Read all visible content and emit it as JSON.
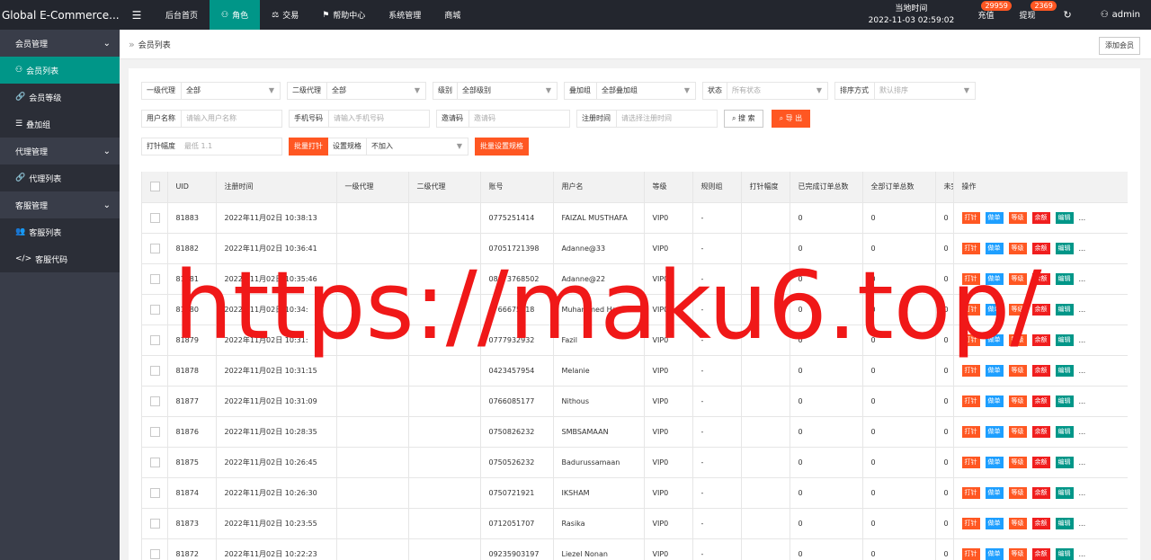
{
  "app": {
    "brand": "Global E-Commerce..."
  },
  "topnav": [
    {
      "label": "后台首页",
      "icon": "",
      "active": false
    },
    {
      "label": "角色",
      "icon": "user-icon",
      "active": true
    },
    {
      "label": "交易",
      "icon": "scale-icon",
      "active": false
    },
    {
      "label": "帮助中心",
      "icon": "flag-icon",
      "active": false
    },
    {
      "label": "系统管理",
      "icon": "",
      "active": false
    },
    {
      "label": "商城",
      "icon": "",
      "active": false
    }
  ],
  "header": {
    "clock_title": "当地时间",
    "clock_value": "2022-11-03 02:59:02",
    "recharge_label": "充值",
    "recharge_badge": "29959",
    "withdraw_label": "提现",
    "withdraw_badge": "2369",
    "user_label": "admin"
  },
  "sidebar": {
    "groups": [
      {
        "label": "会员管理",
        "items": [
          {
            "label": "会员列表",
            "icon": "user-icon",
            "active": true
          },
          {
            "label": "会员等级",
            "icon": "link-icon",
            "active": false
          },
          {
            "label": "叠加组",
            "icon": "list-icon",
            "active": false
          }
        ]
      },
      {
        "label": "代理管理",
        "items": [
          {
            "label": "代理列表",
            "icon": "link-icon",
            "active": false
          }
        ]
      },
      {
        "label": "客服管理",
        "items": [
          {
            "label": "客服列表",
            "icon": "users-icon",
            "active": false
          },
          {
            "label": "客服代码",
            "icon": "code-icon",
            "active": false
          }
        ]
      }
    ]
  },
  "tabbar": {
    "crumb": "会员列表",
    "add_button": "添加会员"
  },
  "filters": {
    "row1": [
      {
        "label": "一级代理",
        "value": "全部"
      },
      {
        "label": "二级代理",
        "value": "全部"
      },
      {
        "label": "级别",
        "value": "全部级别"
      },
      {
        "label": "叠加组",
        "value": "全部叠加组"
      },
      {
        "label": "状态",
        "value": "所有状态"
      },
      {
        "label": "排序方式",
        "value": "默认排序"
      }
    ],
    "row2": [
      {
        "label": "用户名称",
        "placeholder": "请输入用户名称"
      },
      {
        "label": "手机号码",
        "placeholder": "请输入手机号码"
      },
      {
        "label": "邀请码",
        "placeholder": "邀请码"
      },
      {
        "label": "注册时间",
        "placeholder": "请选择注册时间"
      }
    ],
    "search_button": "搜 索",
    "export_button": "导 出",
    "row3": {
      "label": "打针幅度",
      "placeholder": "最低 1.1",
      "batch_button": "批量打针",
      "rule_label": "设置规格",
      "rule_value": "不加入",
      "batch_rule_button": "批量设置规格"
    }
  },
  "table": {
    "columns": [
      "UID",
      "注册时间",
      "一级代理",
      "二级代理",
      "账号",
      "用户名",
      "等级",
      "规则组",
      "打针幅度",
      "已完成订单总数",
      "全部订单总数",
      "未完成",
      "操作"
    ],
    "actions": [
      "打针",
      "做单",
      "等级",
      "余额",
      "编辑"
    ],
    "more": "...",
    "rows": [
      {
        "uid": "81883",
        "time": "2022年11月02日 10:38:13",
        "agent1": "",
        "agent2": "",
        "account": "0775251414",
        "name": "FAIZAL MUSTHAFA",
        "level": "VIP0",
        "rule": "-",
        "range": "",
        "done": "0",
        "total": "0",
        "undone": "0"
      },
      {
        "uid": "81882",
        "time": "2022年11月02日 10:36:41",
        "agent1": "",
        "agent2": "",
        "account": "07051721398",
        "name": "Adanne@33",
        "level": "VIP0",
        "rule": "-",
        "range": "",
        "done": "0",
        "total": "0",
        "undone": "0"
      },
      {
        "uid": "81881",
        "time": "2022年11月02日 10:35:46",
        "agent1": "",
        "agent2": "",
        "account": "08073768502",
        "name": "Adanne@22",
        "level": "VIP0",
        "rule": "-",
        "range": "",
        "done": "0",
        "total": "0",
        "undone": "0"
      },
      {
        "uid": "81880",
        "time": "2022年11月02日 10:34:",
        "agent1": "",
        "agent2": "",
        "account": "0766675118",
        "name": "Muhammed Harun...",
        "level": "VIP0",
        "rule": "-",
        "range": "",
        "done": "0",
        "total": "0",
        "undone": "0"
      },
      {
        "uid": "81879",
        "time": "2022年11月02日 10:31:",
        "agent1": "",
        "agent2": "",
        "account": "0777932932",
        "name": "Fazil",
        "level": "VIP0",
        "rule": "-",
        "range": "",
        "done": "0",
        "total": "0",
        "undone": "0"
      },
      {
        "uid": "81878",
        "time": "2022年11月02日 10:31:15",
        "agent1": "",
        "agent2": "",
        "account": "0423457954",
        "name": "Melanie",
        "level": "VIP0",
        "rule": "-",
        "range": "",
        "done": "0",
        "total": "0",
        "undone": "0"
      },
      {
        "uid": "81877",
        "time": "2022年11月02日 10:31:09",
        "agent1": "",
        "agent2": "",
        "account": "0766085177",
        "name": "Nithous",
        "level": "VIP0",
        "rule": "-",
        "range": "",
        "done": "0",
        "total": "0",
        "undone": "0"
      },
      {
        "uid": "81876",
        "time": "2022年11月02日 10:28:35",
        "agent1": "",
        "agent2": "",
        "account": "0750826232",
        "name": "SMBSAMAAN",
        "level": "VIP0",
        "rule": "-",
        "range": "",
        "done": "0",
        "total": "0",
        "undone": "0"
      },
      {
        "uid": "81875",
        "time": "2022年11月02日 10:26:45",
        "agent1": "",
        "agent2": "",
        "account": "0750526232",
        "name": "Badurussamaan",
        "level": "VIP0",
        "rule": "-",
        "range": "",
        "done": "0",
        "total": "0",
        "undone": "0"
      },
      {
        "uid": "81874",
        "time": "2022年11月02日 10:26:30",
        "agent1": "",
        "agent2": "",
        "account": "0750721921",
        "name": "IKSHAM",
        "level": "VIP0",
        "rule": "-",
        "range": "",
        "done": "0",
        "total": "0",
        "undone": "0"
      },
      {
        "uid": "81873",
        "time": "2022年11月02日 10:23:55",
        "agent1": "",
        "agent2": "",
        "account": "0712051707",
        "name": "Rasika",
        "level": "VIP0",
        "rule": "-",
        "range": "",
        "done": "0",
        "total": "0",
        "undone": "0"
      },
      {
        "uid": "81872",
        "time": "2022年11月02日 10:22:23",
        "agent1": "",
        "agent2": "",
        "account": "09235903197",
        "name": "Liezel Nonan",
        "level": "VIP0",
        "rule": "-",
        "range": "",
        "done": "0",
        "total": "0",
        "undone": "0"
      }
    ]
  },
  "watermark": "https://maku6.top/",
  "colors": {
    "topbar": "#23262e",
    "sidebar": "#393d49",
    "accent": "#009688",
    "orange": "#ff5722",
    "blue": "#1e9fff",
    "red": "#f01e1e",
    "watermark": "#f01818"
  }
}
